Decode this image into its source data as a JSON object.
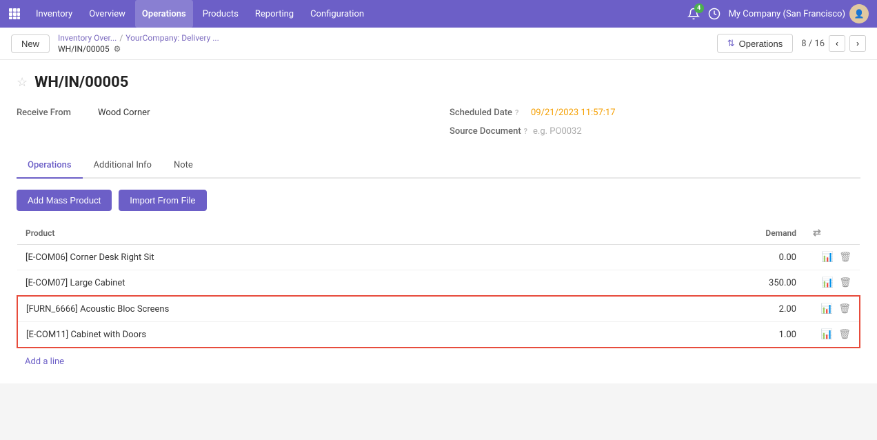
{
  "topnav": {
    "app_name": "Inventory",
    "nav_items": [
      "Overview",
      "Operations",
      "Products",
      "Reporting",
      "Configuration"
    ],
    "active_nav": "Operations",
    "notification_count": "4",
    "company": "My Company (San Francisco)"
  },
  "subheader": {
    "new_label": "New",
    "breadcrumb_part1": "Inventory Over...",
    "breadcrumb_part2": "YourCompany: Delivery ...",
    "record_ref": "WH/IN/00005",
    "operations_button": "Operations",
    "pagination": "8 / 16"
  },
  "record": {
    "title": "WH/IN/00005",
    "receive_from_label": "Receive From",
    "receive_from_value": "Wood Corner",
    "scheduled_date_label": "Scheduled Date",
    "scheduled_date_value": "09/21/2023 11:57:17",
    "source_doc_label": "Source Document",
    "source_doc_placeholder": "e.g. PO0032"
  },
  "tabs": [
    {
      "id": "operations",
      "label": "Operations",
      "active": true
    },
    {
      "id": "additional-info",
      "label": "Additional Info",
      "active": false
    },
    {
      "id": "note",
      "label": "Note",
      "active": false
    }
  ],
  "actions": {
    "add_mass_product": "Add Mass Product",
    "import_from_file": "Import From File"
  },
  "table": {
    "col_product": "Product",
    "col_demand": "Demand",
    "rows": [
      {
        "id": "row1",
        "product": "[E-COM06] Corner Desk Right Sit",
        "demand": "0.00",
        "highlighted": false,
        "chart_style": "red"
      },
      {
        "id": "row2",
        "product": "[E-COM07] Large Cabinet",
        "demand": "350.00",
        "highlighted": false,
        "chart_style": "blue"
      },
      {
        "id": "row3",
        "product": "[FURN_6666] Acoustic Bloc Screens",
        "demand": "2.00",
        "highlighted": true,
        "chart_style": "blue"
      },
      {
        "id": "row4",
        "product": "[E-COM11] Cabinet with Doors",
        "demand": "1.00",
        "highlighted": true,
        "chart_style": "blue"
      }
    ],
    "add_line": "Add a line"
  }
}
